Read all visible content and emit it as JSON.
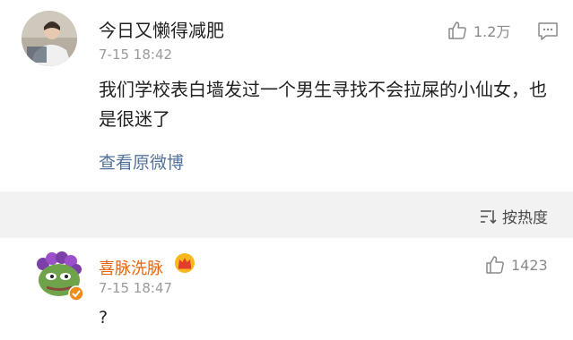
{
  "post": {
    "username": "今日又懒得减肥",
    "time": "7-15 18:42",
    "like_count": "1.2万",
    "body": "我们学校表白墙发过一个男生寻找不会拉屎的小仙女，也是很迷了",
    "view_original": "查看原微博"
  },
  "sort": {
    "label": "按热度"
  },
  "reply": {
    "username": "喜脉洗脉",
    "time": "7-15 18:47",
    "like_count": "1423",
    "body": "?"
  },
  "colors": {
    "link": "#52739c",
    "vip_name": "#e8650f",
    "muted": "#9a9a9a",
    "divider_bg": "#f2f2f2"
  },
  "icons": {
    "like": "thumbs-up-icon",
    "comment": "comment-icon",
    "sort": "sort-icon",
    "crown": "crown-icon",
    "verified": "verified-badge-icon"
  }
}
